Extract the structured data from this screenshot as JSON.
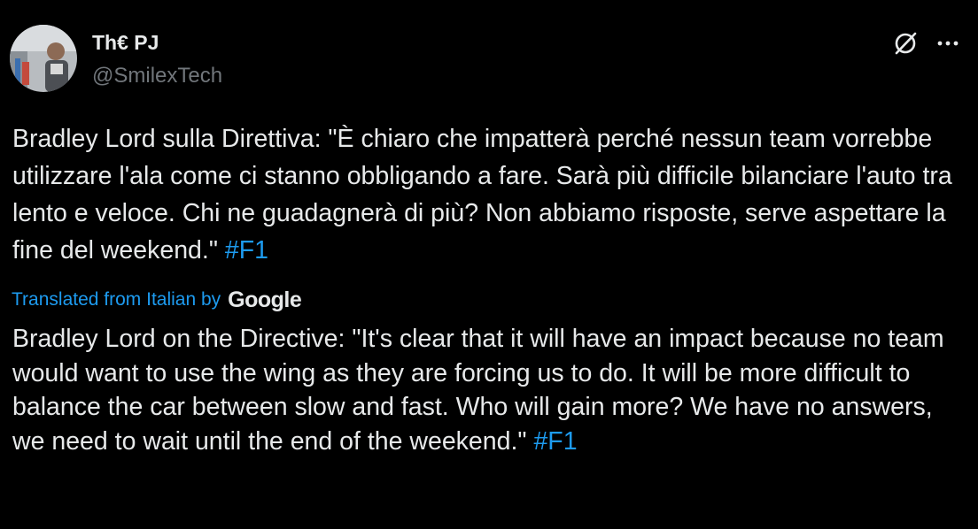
{
  "author": {
    "display_name": "Th€ PJ",
    "handle": "@SmilexTech"
  },
  "header_icons": {
    "grok": "grok-icon",
    "more": "more-options-icon"
  },
  "tweet": {
    "text": "Bradley Lord sulla Direttiva: \"È chiaro che impatterà perché nessun team vorrebbe utilizzare l'ala come ci stanno obbligando a fare. Sarà più difficile bilanciare l'auto tra lento e veloce. Chi ne guadagnerà di più? Non abbiamo risposte, serve aspettare la fine del weekend.\"",
    "hashtag": "#F1"
  },
  "translation": {
    "label": "Translated from Italian by",
    "provider": "Google",
    "text": "Bradley Lord on the Directive: \"It's clear that it will have an impact because no team would want to use the wing as they are forcing us to do. It will be more difficult to balance the car between slow and fast. Who will gain more? We have no answers, we need to wait until the end of the weekend.\"",
    "hashtag": "#F1"
  },
  "colors": {
    "background": "#000000",
    "text": "#e7e9ea",
    "secondary": "#71767b",
    "accent": "#1d9bf0"
  }
}
